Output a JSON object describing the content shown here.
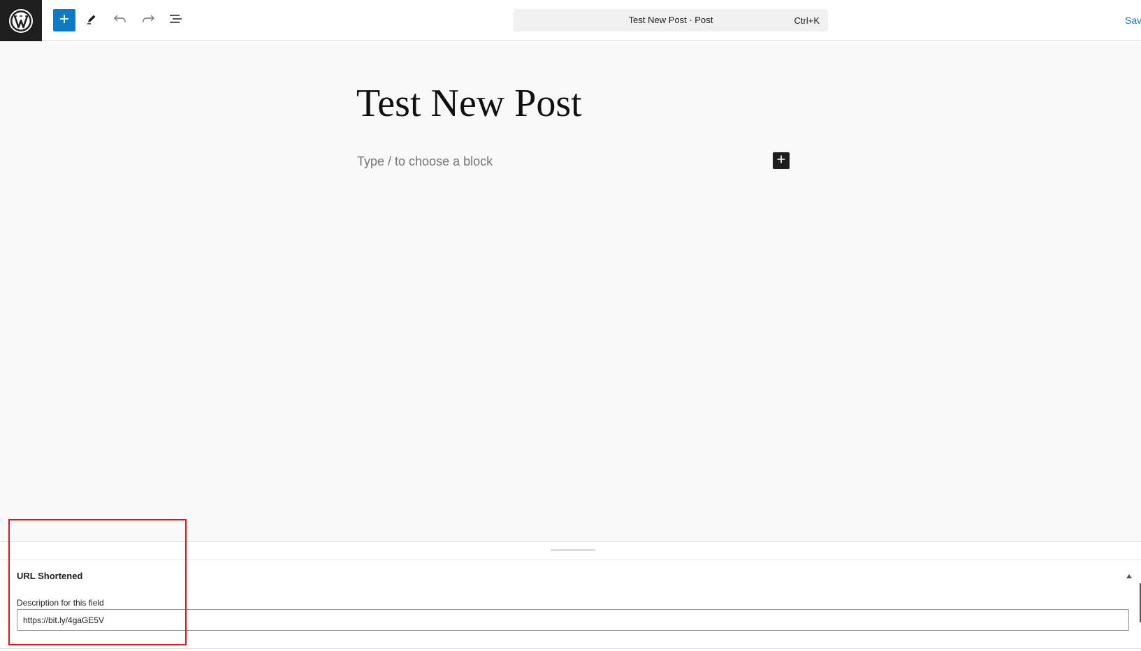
{
  "toolbar": {
    "logo_icon": "wordpress-logo-icon",
    "inserter_icon": "plus-icon",
    "tools_icon": "pencil-icon",
    "undo_icon": "undo-icon",
    "redo_icon": "redo-icon",
    "outline_icon": "document-overview-icon",
    "command_title": "Test New Post · Post",
    "command_shortcut": "Ctrl+K",
    "save_label": "Save"
  },
  "editor": {
    "post_title": "Test New Post",
    "block_placeholder": "Type / to choose a block",
    "add_block_icon": "plus-icon"
  },
  "meta_box": {
    "heading": "URL Shortened",
    "toggle_icon": "triangle-up-icon",
    "field_label": "Description for this field",
    "field_value": "https://bit.ly/4gaGE5V"
  },
  "colors": {
    "accent": "#0a7bc4",
    "highlight": "#e8141c",
    "logo_bg": "#1e1e1e"
  }
}
